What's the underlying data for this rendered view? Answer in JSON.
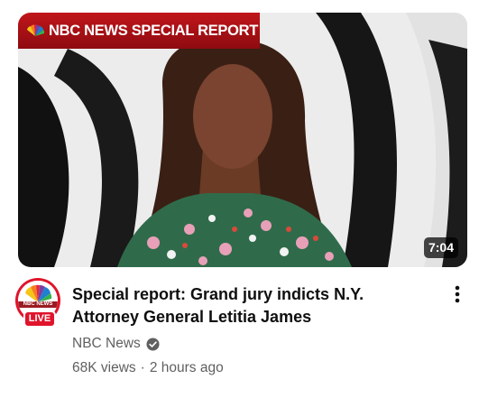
{
  "video": {
    "banner_text": "NBC NEWS SPECIAL REPORT",
    "duration": "7:04",
    "title": "Special report: Grand jury indicts N.Y. Attorney General Letitia James",
    "channel": "NBC News",
    "views": "68K views",
    "separator": "·",
    "age": "2 hours ago"
  },
  "avatar": {
    "brand_text": "NBC NEWS",
    "live_label": "LIVE"
  },
  "icons": {
    "banner_logo": "nbc-peacock-icon",
    "avatar_logo": "nbc-peacock-icon",
    "verified": "verified-check-icon",
    "more": "more-vertical-icon"
  },
  "colors": {
    "banner_red": "#c0161b",
    "live_red": "#e0142b",
    "title_text": "#0f0f0f",
    "secondary_text": "#606060"
  }
}
